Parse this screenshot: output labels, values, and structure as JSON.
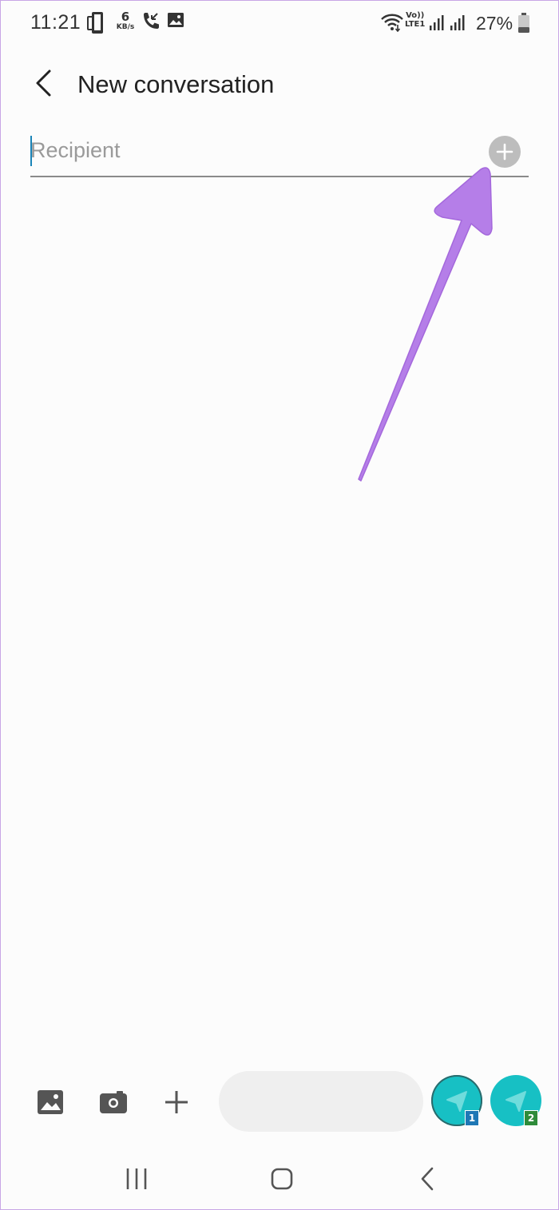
{
  "status_bar": {
    "time": "11:21",
    "net_speed_value": "6",
    "net_speed_unit": "KB/s",
    "volte_top": "Vo))",
    "volte_bottom": "LTE1",
    "battery": "27%",
    "icons": [
      "screen-mirror-icon",
      "missed-call-icon",
      "image-icon",
      "wifi-icon",
      "signal-icon",
      "battery-icon"
    ]
  },
  "header": {
    "back_icon": "back-arrow-icon",
    "title": "New conversation"
  },
  "recipient": {
    "placeholder": "Recipient",
    "value": "",
    "add_icon": "plus-circle-icon"
  },
  "annotation": {
    "color": "#b57ee8"
  },
  "composer": {
    "tools": [
      "gallery-icon",
      "camera-icon",
      "plus-icon"
    ],
    "message_value": "",
    "send_sim1_badge": "1",
    "send_sim2_badge": "2",
    "accent": "#17c0c4"
  },
  "nav_bar": {
    "buttons": [
      "recent-apps-icon",
      "home-icon",
      "back-icon"
    ]
  }
}
